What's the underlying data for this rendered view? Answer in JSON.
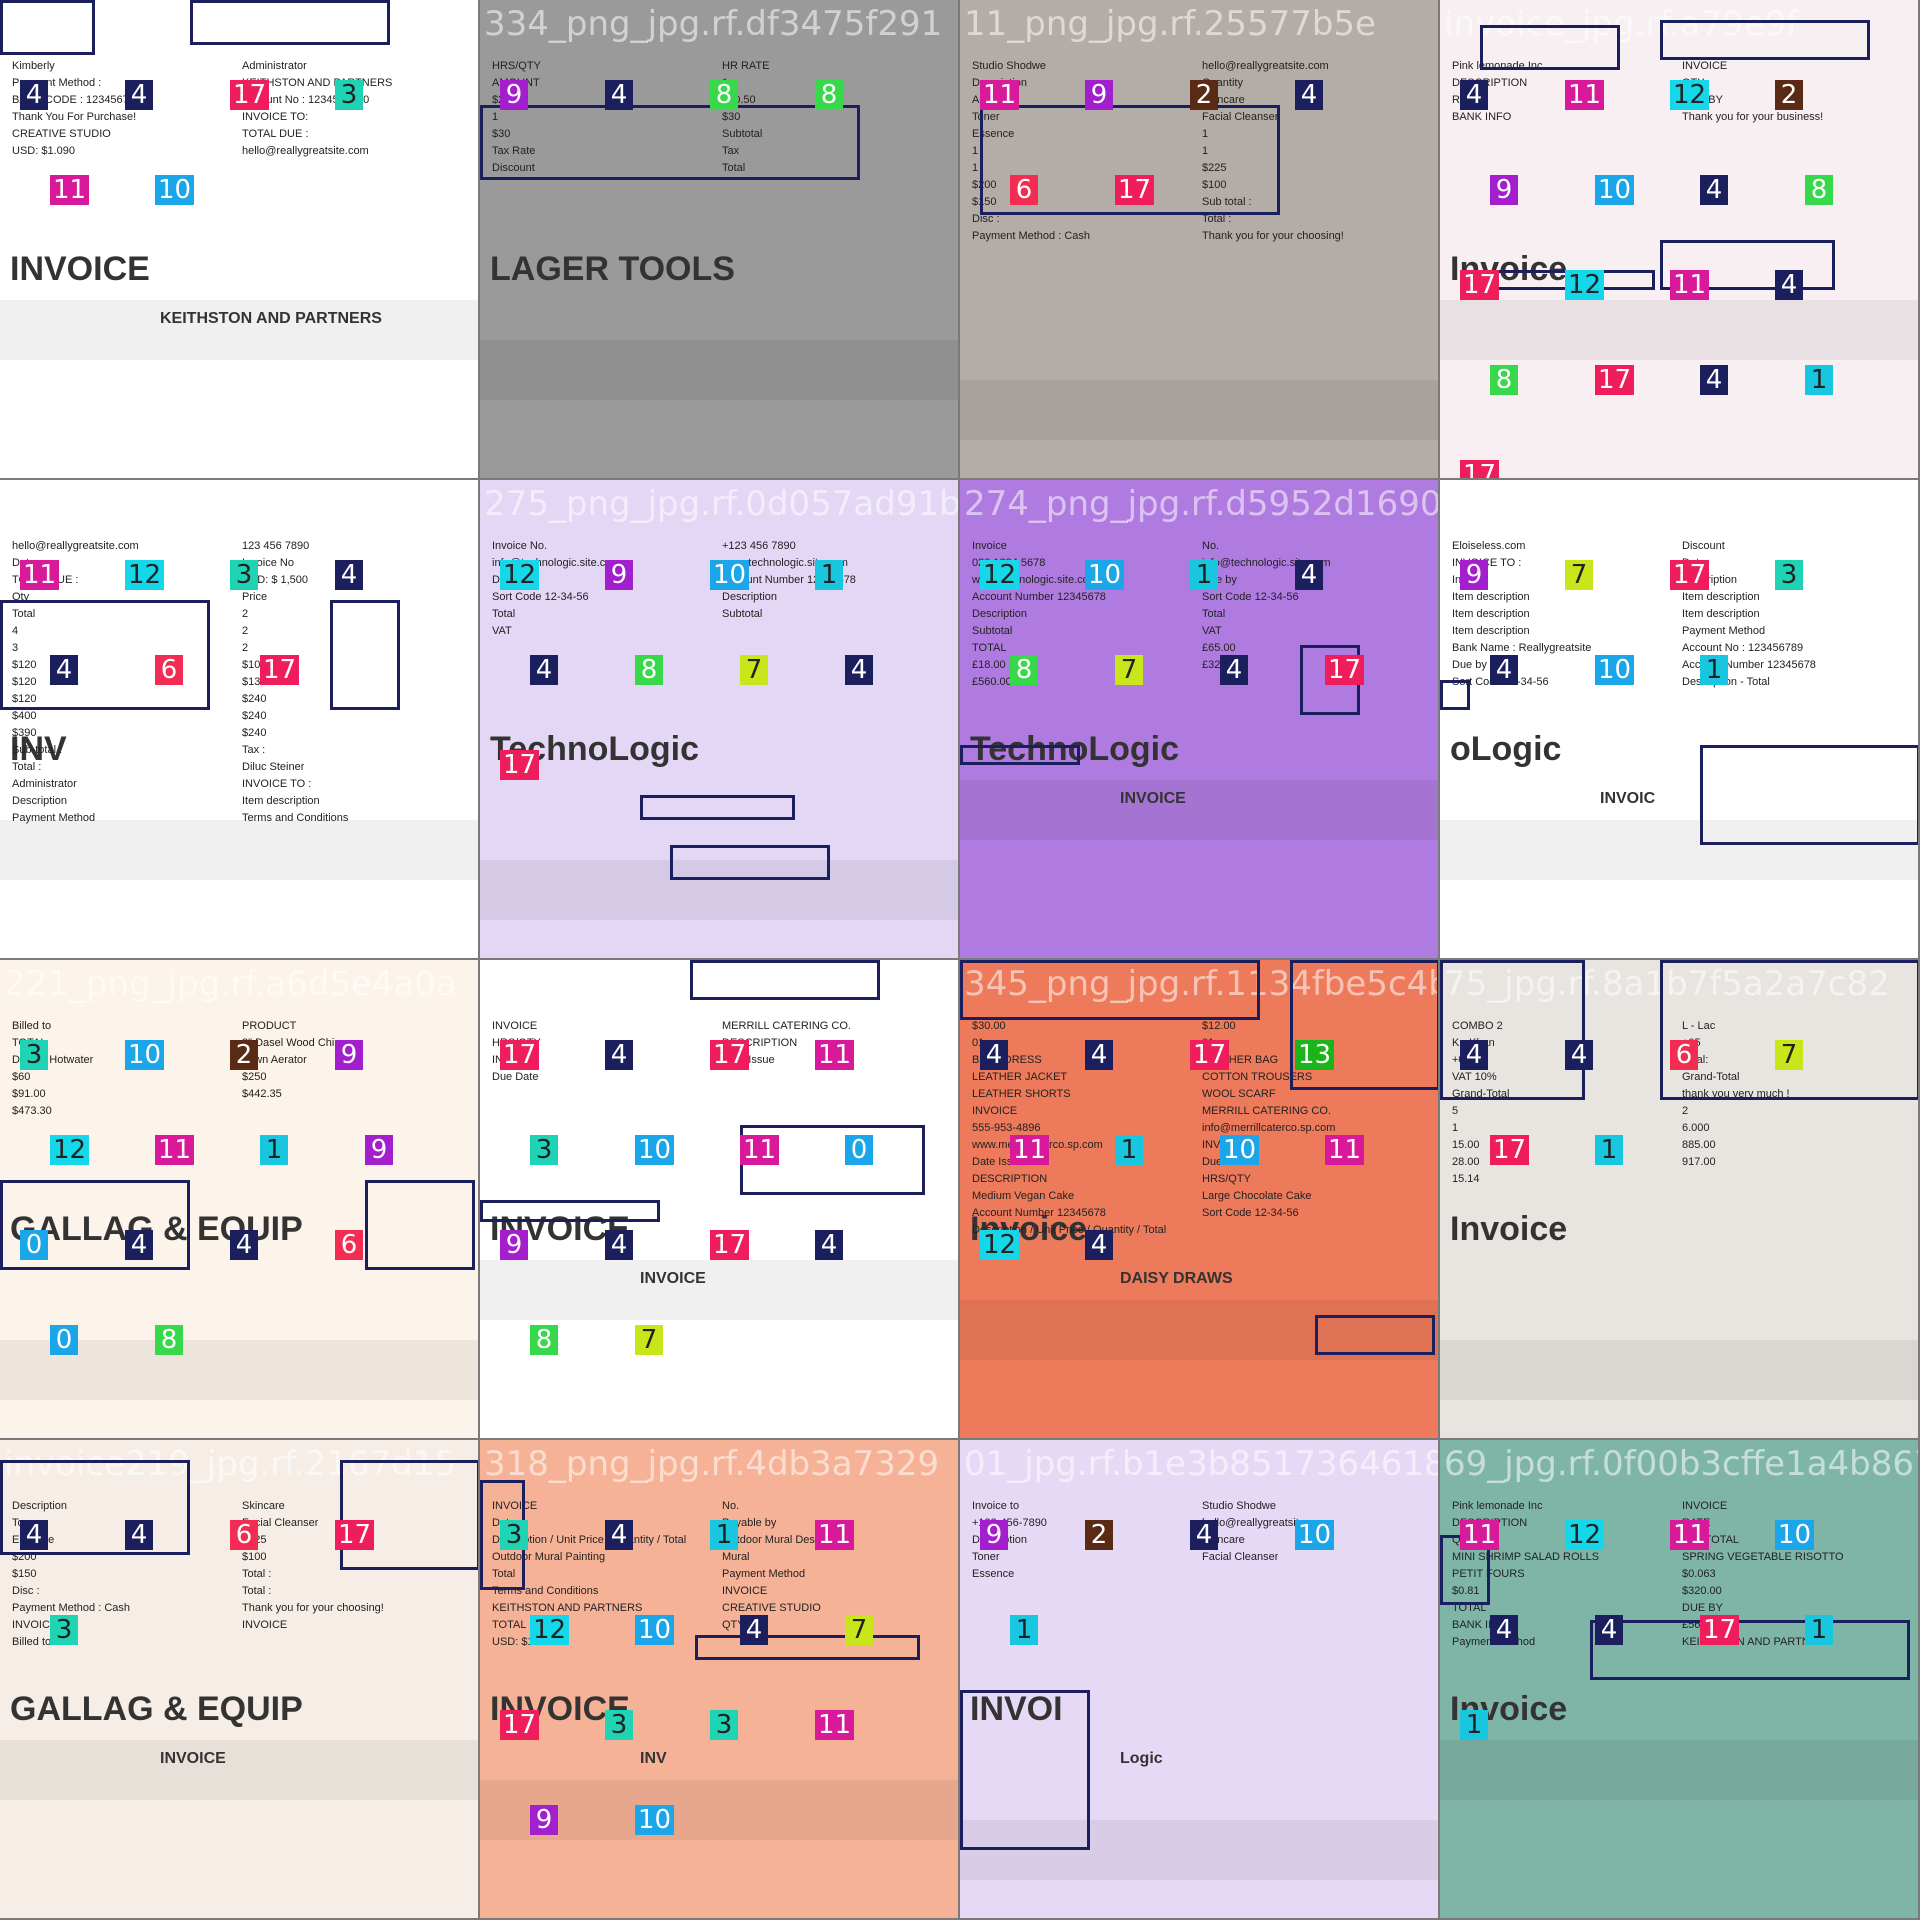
{
  "class_colors": {
    "1": "#19c6e0",
    "2": "#5a2a14",
    "3": "#1fd3b5",
    "4": "#1b1f5e",
    "6": "#f22c52",
    "7": "#c8e61a",
    "8": "#37d94a",
    "9": "#a31ecc",
    "10": "#1aa6e8",
    "11": "#d8199a",
    "12": "#14d8ea",
    "13": "#1bb51b",
    "17": "#f01d5c"
  },
  "tiles": [
    {
      "label": "invoice160_jpg.rf.1c1c2e1eb",
      "bg": "#ffffff",
      "texts": [
        "Kimberly",
        "Administrator",
        "Payment Method :",
        "KEITHSTON AND PARTNERS",
        "BANK CODE : 1234567890",
        "Account No : 1234567890",
        "Thank You For Purchase!",
        "INVOICE TO:",
        "CREATIVE STUDIO",
        "TOTAL DUE :",
        "USD: $1.090",
        "hello@reallygreatsite.com"
      ],
      "big": [
        "INVOICE",
        "KEITHSTON AND PARTNERS"
      ],
      "tags": [
        "4",
        "4",
        "17",
        "3",
        "11",
        "10"
      ]
    },
    {
      "label": "334_png_jpg.rf.df3475f291",
      "bg": "#9a9a9a",
      "texts": [
        "HRS/QTY",
        "HR RATE",
        "AMOUNT",
        "1",
        "$20.50",
        "$20.50",
        "1",
        "$30",
        "$30",
        "Subtotal",
        "Tax Rate",
        "Tax",
        "Discount",
        "Total"
      ],
      "big": [
        "LAGER TOOLS"
      ],
      "tags": [
        "9",
        "4",
        "8",
        "8"
      ]
    },
    {
      "label": "11_png_jpg.rf.25577b5e",
      "bg": "#b4aca6",
      "texts": [
        "Studio Shodwe",
        "hello@reallygreatsite.com",
        "Description",
        "Quantity",
        "Amount",
        "Skincare",
        "Toner",
        "Facial Cleanser",
        "Essence",
        "1",
        "1",
        "1",
        "1",
        "$225",
        "$200",
        "$100",
        "$150",
        "Sub total :",
        "Disc :",
        "Total :",
        "Payment Method : Cash",
        "Thank you for your choosing!"
      ],
      "big": [],
      "tags": [
        "11",
        "9",
        "2",
        "4",
        "6",
        "17"
      ]
    },
    {
      "label": "invoice_jpg.rf.a79e9f",
      "bg": "#f7eff1",
      "texts": [
        "Pink lemonade Inc",
        "INVOICE",
        "DESCRIPTION",
        "QTY",
        "RATE",
        "DUE BY",
        "BANK INFO",
        "Thank you for your business!"
      ],
      "big": [
        "Invoice"
      ],
      "tags": [
        "4",
        "11",
        "12",
        "2",
        "9",
        "10",
        "4",
        "8",
        "17",
        "12",
        "11",
        "4",
        "8",
        "17",
        "4",
        "1",
        "17"
      ]
    },
    {
      "label": "305_png_jpg.rf.9ddc95f2db",
      "bg": "#ffffff",
      "texts": [
        "hello@reallygreatsite.com",
        "123 456 7890",
        "Date",
        "Invoice No",
        "TOTAL DUE :",
        "USD: $ 1,500",
        "Qty",
        "Price",
        "Total",
        "2",
        "4",
        "2",
        "3",
        "2",
        "$120",
        "$100",
        "$120",
        "$130",
        "$120",
        "$240",
        "$400",
        "$240",
        "$390",
        "$240",
        "Sub-total :",
        "Tax :",
        "Total :",
        "Diluc Steiner",
        "Administrator",
        "INVOICE TO :",
        "Description",
        "Item description",
        "Payment Method",
        "Terms and Conditions"
      ],
      "big": [
        "INV"
      ],
      "tags": [
        "11",
        "12",
        "3",
        "4",
        "4",
        "6",
        "17"
      ]
    },
    {
      "label": "275_png_jpg.rf.0d057ad91b",
      "bg": "#e3d7f5",
      "texts": [
        "Invoice No.",
        "+123 456 7890",
        "info@technologic.site.com",
        "www.technologic.site.com",
        "Due by",
        "Account Number 12345678",
        "Sort Code 12-34-56",
        "Description",
        "Total",
        "Subtotal",
        "VAT"
      ],
      "big": [
        "TechnoLogic"
      ],
      "tags": [
        "12",
        "9",
        "10",
        "1",
        "4",
        "8",
        "7",
        "4",
        "17"
      ]
    },
    {
      "label": "274_png_jpg.rf.d5952d169051",
      "bg": "#b07be0",
      "texts": [
        "Invoice",
        "No.",
        "020 1234 5678",
        "info@technologic.site.com",
        "www.technologic.site.com",
        "Due by",
        "Account Number 12345678",
        "Sort Code 12-34-56",
        "Description",
        "Total",
        "Subtotal",
        "VAT",
        "TOTAL",
        "£65.00",
        "£18.00",
        "£320.00",
        "£560.00"
      ],
      "big": [
        "TechnoLogic",
        "INVOICE"
      ],
      "tags": [
        "12",
        "10",
        "1",
        "4",
        "8",
        "7",
        "4",
        "17"
      ]
    },
    {
      "label": "37_png_jpg.rf.5f879...53fea0",
      "bg": "#ffffff",
      "texts": [
        "Eloiseless.com",
        "Discount",
        "INVOICE TO :",
        "Date",
        "Invoice",
        "Description",
        "Item description",
        "Item description",
        "Item description",
        "Item description",
        "Item description",
        "Payment Method",
        "Bank Name : Reallygreatsite",
        "Account No : 123456789",
        "Due by",
        "Account Number 12345678",
        "Sort Code 12-34-56",
        "Description - Total"
      ],
      "big": [
        "oLogic",
        "INVOIC"
      ],
      "tags": [
        "9",
        "7",
        "17",
        "3",
        "4",
        "10",
        "1"
      ]
    },
    {
      "label": "221_png_jpg.rf.a6d5e4a0a",
      "bg": "#fcf3ea",
      "texts": [
        "Billed to",
        "PRODUCT",
        "TOTAL",
        "8\" Dasel Wood Chipper",
        "Deluxe Hotwater",
        "Lawn Aerator",
        "$60",
        "$250",
        "$91.00",
        "$442.35",
        "$473.30"
      ],
      "big": [
        "GALLAG & EQUIP"
      ],
      "tags": [
        "3",
        "10",
        "2",
        "9",
        "12",
        "11",
        "1",
        "9",
        "0",
        "4",
        "4",
        "6",
        "0",
        "8"
      ]
    },
    {
      "label": "16_jpg.rf.8e635058dee11e545",
      "bg": "#ffffff",
      "texts": [
        "INVOICE",
        "MERRILL CATERING CO.",
        "HRS/QTY",
        "DESCRIPTION",
        "INVOICE",
        "Date Issue",
        "Due Date"
      ],
      "big": [
        "INVOICE",
        "INVOICE"
      ],
      "tags": [
        "17",
        "4",
        "17",
        "11",
        "3",
        "10",
        "11",
        "0",
        "9",
        "4",
        "17",
        "4",
        "8",
        "7"
      ]
    },
    {
      "label": "345_png_jpg.rf.1134fbe5c4b41",
      "bg": "#ed7a5a",
      "texts": [
        "$30.00",
        "$12.00",
        "01",
        "01",
        "BLUE DRESS",
        "LEATHER BAG",
        "LEATHER JACKET",
        "COTTON TROUSERS",
        "LEATHER SHORTS",
        "WOOL SCARF",
        "INVOICE",
        "MERRILL CATERING CO.",
        "555-953-4896",
        "info@merrillcaterco.sp.com",
        "www.merrillcaterco.sp.com",
        "INVOICE",
        "Date Issue",
        "Due Date",
        "DESCRIPTION",
        "HRS/QTY",
        "Medium Vegan Cake",
        "Large Chocolate Cake",
        "Account Number 12345678",
        "Sort Code 12-34-56",
        "Description / Unit Price / Quantity / Total"
      ],
      "big": [
        "Invoice",
        "DAISY DRAWS"
      ],
      "tags": [
        "4",
        "4",
        "17",
        "13",
        "11",
        "1",
        "10",
        "11",
        "12",
        "4"
      ]
    },
    {
      "label": "75_jpg.rf.8a1b7f5a2a7c82",
      "bg": "#e8e4e0",
      "texts": [
        "COMBO 2",
        "L - Lac",
        "K - Khan",
        "+05",
        "+01",
        "Total:",
        "VAT 10%",
        "Grand-Total",
        "Grand-Total",
        "thank you very much !",
        "5",
        "2",
        "1",
        "6.000",
        "15.00",
        "885.00",
        "28.00",
        "917.00",
        "15.14"
      ],
      "big": [
        "Invoice"
      ],
      "tags": [
        "4",
        "4",
        "6",
        "7",
        "17",
        "1"
      ]
    },
    {
      "label": "invoice219_jpg.rf.2167d15",
      "bg": "#f6eee6",
      "texts": [
        "Description",
        "Skincare",
        "Toner",
        "Facial Cleanser",
        "Essence",
        "$225",
        "$200",
        "$100",
        "$150",
        "Total :",
        "Disc :",
        "Total :",
        "Payment Method : Cash",
        "Thank you for your choosing!",
        "INVOICE",
        "INVOICE",
        "Billed to"
      ],
      "big": [
        "GALLAG & EQUIP",
        "INVOICE"
      ],
      "tags": [
        "4",
        "4",
        "6",
        "17",
        "3"
      ]
    },
    {
      "label": "318_png_jpg.rf.4db3a7329",
      "bg": "#f6b296",
      "texts": [
        "INVOICE",
        "No.",
        "Date",
        "Payable by",
        "Description / Unit Price / Quantity / Total",
        "Outdoor Mural Design",
        "Outdoor Mural Painting",
        "Mural",
        "Total",
        "Payment Method",
        "Terms and Conditions",
        "INVOICE",
        "KEITHSTON AND PARTNERS",
        "CREATIVE STUDIO",
        "TOTAL",
        "QTY",
        "USD: $1.090"
      ],
      "big": [
        "INVOICE",
        "INV"
      ],
      "tags": [
        "3",
        "4",
        "1",
        "11",
        "12",
        "10",
        "4",
        "7",
        "17",
        "3",
        "3",
        "11",
        "9",
        "10"
      ]
    },
    {
      "label": "01_jpg.rf.b1e3b8517364618231",
      "bg": "#e6d9f5",
      "texts": [
        "Invoice to",
        "Studio Shodwe",
        "+123-456-7890",
        "hello@reallygreatsite.com",
        "Description",
        "Skincare",
        "Toner",
        "Facial Cleanser",
        "Essence"
      ],
      "big": [
        "INVOI",
        "Logic"
      ],
      "tags": [
        "9",
        "2",
        "4",
        "10",
        "1"
      ]
    },
    {
      "label": "69_jpg.rf.0f00b3cffe1a4b86708",
      "bg": "#7fb5a6",
      "texts": [
        "Pink lemonade Inc",
        "INVOICE",
        "DESCRIPTION",
        "RATE",
        "QTY",
        "SUBTOTAL",
        "MINI SHRIMP SALAD ROLLS",
        "SPRING VEGETABLE RISOTTO",
        "PETIT FOURS",
        "$0.063",
        "$0.81",
        "$320.00",
        "TOTAL",
        "DUE BY",
        "BANK INFO",
        "£560.00",
        "Payment Method",
        "KEITHSTON AND PARTNERS"
      ],
      "big": [
        "Invoice"
      ],
      "tags": [
        "11",
        "12",
        "11",
        "10",
        "4",
        "4",
        "17",
        "1",
        "1"
      ]
    }
  ]
}
